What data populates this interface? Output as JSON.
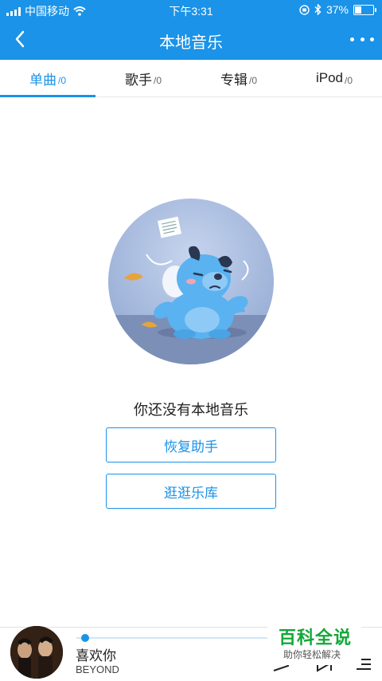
{
  "status_bar": {
    "carrier": "中国移动",
    "time": "下午3:31",
    "battery_percent": "37%",
    "battery_level": 0.37,
    "icons": [
      "signal-icon",
      "wifi-icon",
      "orientation-lock-icon",
      "bluetooth-icon",
      "battery-icon"
    ]
  },
  "nav": {
    "title": "本地音乐",
    "back_icon": "chevron-left-icon",
    "more_icon": "more-dots-icon"
  },
  "tabs": [
    {
      "label": "单曲",
      "count": "/0",
      "active": true
    },
    {
      "label": "歌手",
      "count": "/0",
      "active": false
    },
    {
      "label": "专辑",
      "count": "/0",
      "active": false
    },
    {
      "label": "iPod",
      "count": "/0",
      "active": false
    }
  ],
  "empty_state": {
    "illustration": "sad-blue-dog-illustration",
    "message": "你还没有本地音乐",
    "buttons": [
      "恢复助手",
      "逛逛乐库"
    ]
  },
  "player": {
    "song_title": "喜欢你",
    "artist": "BEYOND",
    "progress": 0.04,
    "controls": [
      "play-icon",
      "next-icon",
      "playlist-icon"
    ]
  },
  "watermark": {
    "title": "百科全说",
    "subtitle": "助你轻松解决"
  },
  "colors": {
    "accent": "#1a93e8",
    "watermark_green": "#13a838"
  }
}
